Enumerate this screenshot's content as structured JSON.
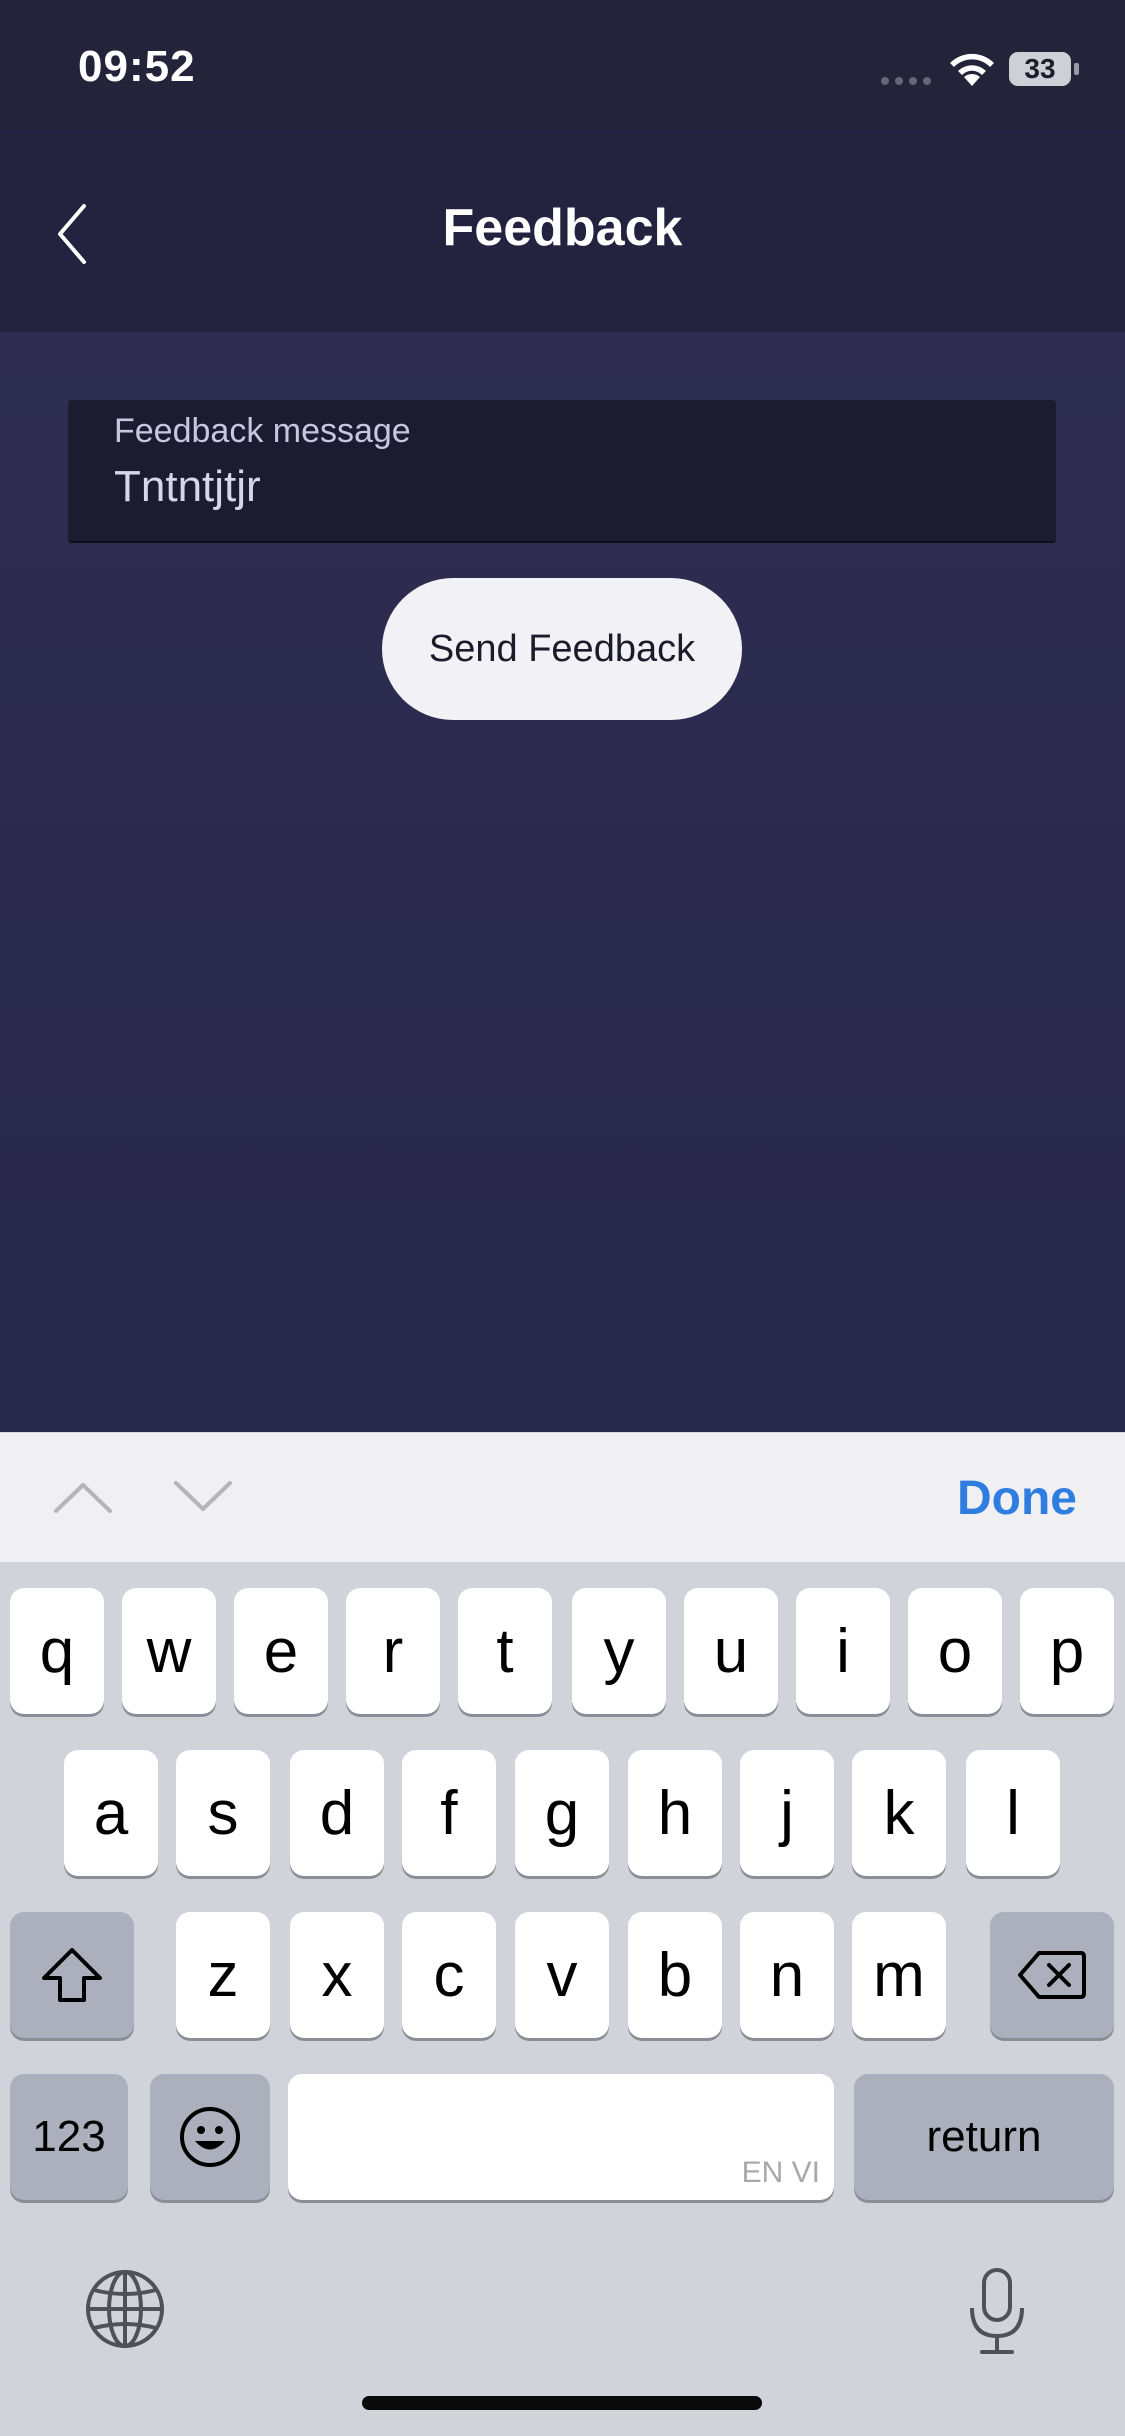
{
  "status_bar": {
    "time": "09:52",
    "battery_level": "33"
  },
  "nav": {
    "title": "Feedback",
    "back_icon": "chevron-left-icon"
  },
  "form": {
    "field_label": "Feedback message",
    "field_value": "Tntntjtjr",
    "send_label": "Send Feedback"
  },
  "accessory": {
    "done_label": "Done"
  },
  "keyboard": {
    "row1": [
      "q",
      "w",
      "e",
      "r",
      "t",
      "y",
      "u",
      "i",
      "o",
      "p"
    ],
    "row2": [
      "a",
      "s",
      "d",
      "f",
      "g",
      "h",
      "j",
      "k",
      "l"
    ],
    "row3": [
      "z",
      "x",
      "c",
      "v",
      "b",
      "n",
      "m"
    ],
    "numbers_label": "123",
    "return_label": "return",
    "space_languages": "EN VI"
  },
  "colors": {
    "accent_done": "#2f7de0",
    "nav_background": "#23223f",
    "content_background": "#2f2d52"
  }
}
